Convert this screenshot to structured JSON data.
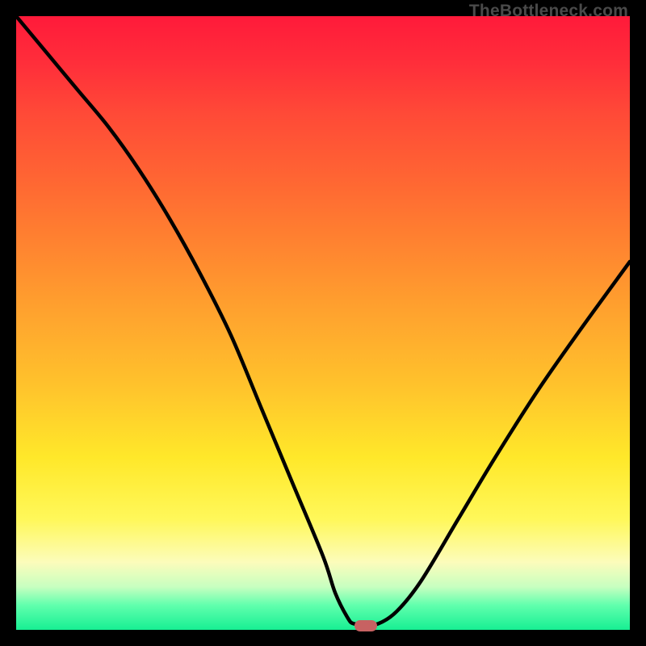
{
  "attribution": "TheBottleneck.com",
  "colors": {
    "frame": "#000000",
    "curve": "#000000",
    "marker": "#c76262",
    "gradient_stops": [
      "#ff1a3a",
      "#ff2f3a",
      "#ff4a37",
      "#ff6433",
      "#ff8030",
      "#ffa22e",
      "#ffc22c",
      "#ffe82a",
      "#fff85a",
      "#fcfcbb",
      "#c7ffc0",
      "#60ffad",
      "#17ef93"
    ]
  },
  "chart_data": {
    "type": "line",
    "title": "",
    "xlabel": "",
    "ylabel": "",
    "xlim": [
      0,
      100
    ],
    "ylim": [
      0,
      100
    ],
    "legend": false,
    "grid": false,
    "series": [
      {
        "name": "left-descent",
        "x": [
          0,
          5,
          10,
          15,
          20,
          25,
          30,
          35,
          40,
          45,
          50,
          52,
          54,
          55
        ],
        "values": [
          100,
          94,
          88,
          82,
          75,
          67,
          58,
          48,
          36,
          24,
          12,
          6,
          2,
          1
        ]
      },
      {
        "name": "valley-floor",
        "x": [
          55,
          57,
          59
        ],
        "values": [
          1,
          1,
          1
        ]
      },
      {
        "name": "right-ascent",
        "x": [
          59,
          62,
          66,
          72,
          78,
          85,
          92,
          100
        ],
        "values": [
          1,
          3,
          8,
          18,
          28,
          39,
          49,
          60
        ]
      }
    ],
    "marker": {
      "x": 57,
      "y": 0.6
    }
  }
}
